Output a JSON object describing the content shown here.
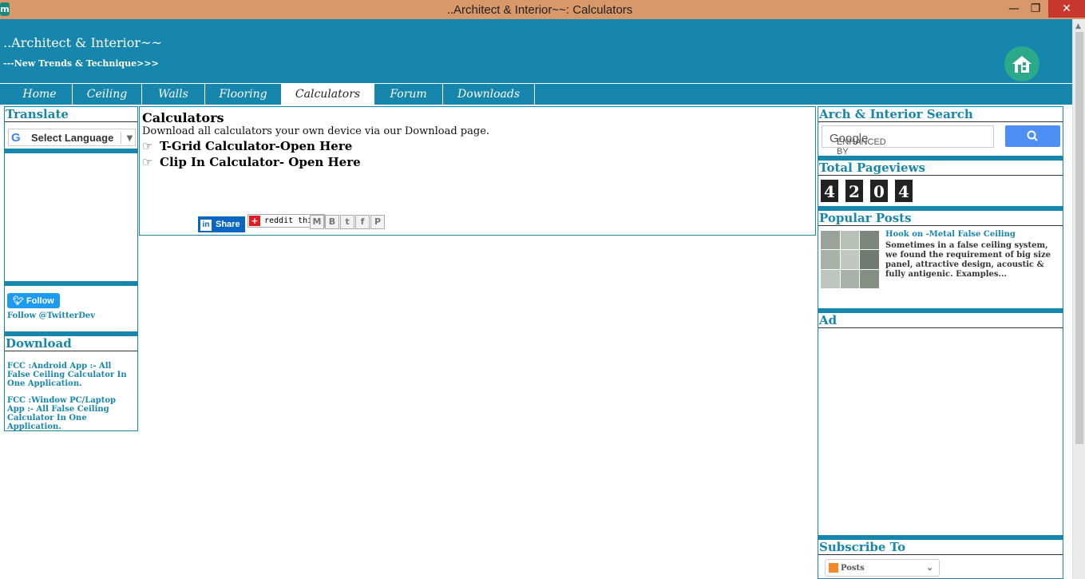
{
  "window": {
    "title": "..Architect & Interior~~: Calculators",
    "minimize": "—",
    "maximize": "❐",
    "close": "✕"
  },
  "header": {
    "site_title": "..Architect & Interior~~",
    "tagline": "---New Trends & Technique>>>"
  },
  "nav": {
    "tabs": [
      "Home",
      "Ceiling",
      "Walls",
      "Flooring",
      "Calculators",
      "Forum",
      "Downloads"
    ],
    "active": "Calculators"
  },
  "left_sidebar": {
    "translate_title": "Translate",
    "language_select": "Select Language",
    "follow_button": "Follow",
    "follow_link": "Follow @TwitterDev",
    "download_title": "Download",
    "downloads": [
      "FCC :Android App :- All False Ceiling Calculator In One Application.",
      "FCC :Window PC/Laptop App :- All False Ceiling Calculator In One Application."
    ]
  },
  "main": {
    "post_title": "Calculators",
    "description": "Download all calculators your own device via our  Download page.",
    "links": [
      "T-Grid Calculator-Open Here",
      "Clip In Calculator- Open Here"
    ],
    "share_label": "Share",
    "reddit_label": "reddit this!",
    "share_icons": [
      "M",
      "B",
      "t",
      "f",
      "P"
    ]
  },
  "right_sidebar": {
    "search_title": "Arch & Interior Search",
    "search_placeholder_prefix": "ENHANCED BY",
    "search_placeholder_brand": "Google",
    "pageviews_title": "Total Pageviews",
    "pageviews_digits": [
      "4",
      "2",
      "0",
      "4"
    ],
    "popular_title": "Popular Posts",
    "popular_post_title": "Hook on -Metal False Ceiling",
    "popular_post_snippet": "Sometimes in a false ceiling system, we found the requirement of big size panel, attractive design, acoustic & fully antigenic. Examples...",
    "ad_title": "Ad",
    "subscribe_title": "Subscribe To",
    "subscribe_option": "Posts"
  },
  "colors": {
    "brand": "#1786ac",
    "titlebar": "#d8986a",
    "close": "#c8372d"
  }
}
